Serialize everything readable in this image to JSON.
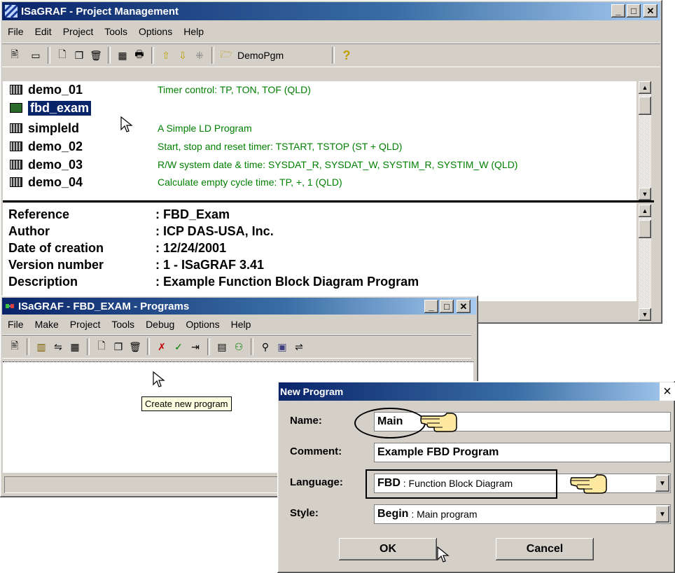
{
  "project_window": {
    "title": "ISaGRAF - Project Management",
    "menu": [
      "File",
      "Edit",
      "Project",
      "Tools",
      "Options",
      "Help"
    ],
    "toolbar_program_label": "DemoPgm",
    "programs": [
      {
        "name": "demo_01",
        "comment": "Timer control:  TP, TON, TOF  (QLD)"
      },
      {
        "name": "fbd_exam",
        "comment": ""
      },
      {
        "name": "simpleld",
        "comment": "A Simple LD Program"
      },
      {
        "name": "demo_02",
        "comment": "Start, stop and reset timer:  TSTART, TSTOP  (ST + QLD)"
      },
      {
        "name": "demo_03",
        "comment": "R/W system date & time:  SYSDAT_R, SYSDAT_W, SYSTIM_R, SYSTIM_W  (QLD)"
      },
      {
        "name": "demo_04",
        "comment": "Calculate empty cycle time:  TP, +, 1  (QLD)"
      }
    ],
    "info": [
      {
        "label": "Reference",
        "value": ": FBD_Exam"
      },
      {
        "label": "Author",
        "value": ": ICP DAS-USA, Inc."
      },
      {
        "label": "Date of creation",
        "value": ": 12/24/2001"
      },
      {
        "label": "Version number",
        "value": ": 1 - ISaGRAF 3.41"
      },
      {
        "label": "Description",
        "value": ": Example Function Block Diagram Program"
      }
    ]
  },
  "programs_window": {
    "title": "ISaGRAF - FBD_EXAM - Programs",
    "menu": [
      "File",
      "Make",
      "Project",
      "Tools",
      "Debug",
      "Options",
      "Help"
    ],
    "tooltip": "Create new program"
  },
  "new_program_dialog": {
    "title": "New Program",
    "close": "×",
    "name_label": "Name:",
    "name_value": "Main",
    "comment_label": "Comment:",
    "comment_value": "Example FBD Program",
    "language_label": "Language:",
    "language_bold": "FBD",
    "language_rest": " : Function Block Diagram",
    "style_label": "Style:",
    "style_bold": "Begin",
    "style_rest": " : Main program",
    "ok": "OK",
    "cancel": "Cancel"
  },
  "colors": {
    "titlebar": "#0a246a",
    "selection": "#0a246a",
    "comment_text": "#008000",
    "face": "#d4d0c8"
  }
}
